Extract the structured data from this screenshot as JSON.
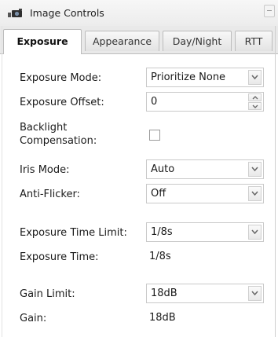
{
  "window": {
    "title": "Image Controls"
  },
  "tabs": [
    {
      "label": "Exposure",
      "active": true
    },
    {
      "label": "Appearance",
      "active": false
    },
    {
      "label": "Day/Night",
      "active": false
    },
    {
      "label": "RTT",
      "active": false
    }
  ],
  "fields": {
    "exposure_mode": {
      "label": "Exposure Mode:",
      "value": "Prioritize None"
    },
    "exposure_offset": {
      "label": "Exposure Offset:",
      "value": "0"
    },
    "backlight": {
      "label_line1": "Backlight",
      "label_line2": "Compensation:",
      "checked": false
    },
    "iris_mode": {
      "label": "Iris Mode:",
      "value": "Auto"
    },
    "anti_flicker": {
      "label": "Anti-Flicker:",
      "value": "Off"
    },
    "exposure_time_limit": {
      "label": "Exposure Time Limit:",
      "value": "1/8s"
    },
    "exposure_time": {
      "label": "Exposure Time:",
      "value": "1/8s"
    },
    "gain_limit": {
      "label": "Gain Limit:",
      "value": "18dB"
    },
    "gain": {
      "label": "Gain:",
      "value": "18dB"
    }
  },
  "colors": {
    "tab_active_bg": "#ffffff",
    "tab_bg": "#e3e3e3",
    "border": "#c9c9c9"
  }
}
